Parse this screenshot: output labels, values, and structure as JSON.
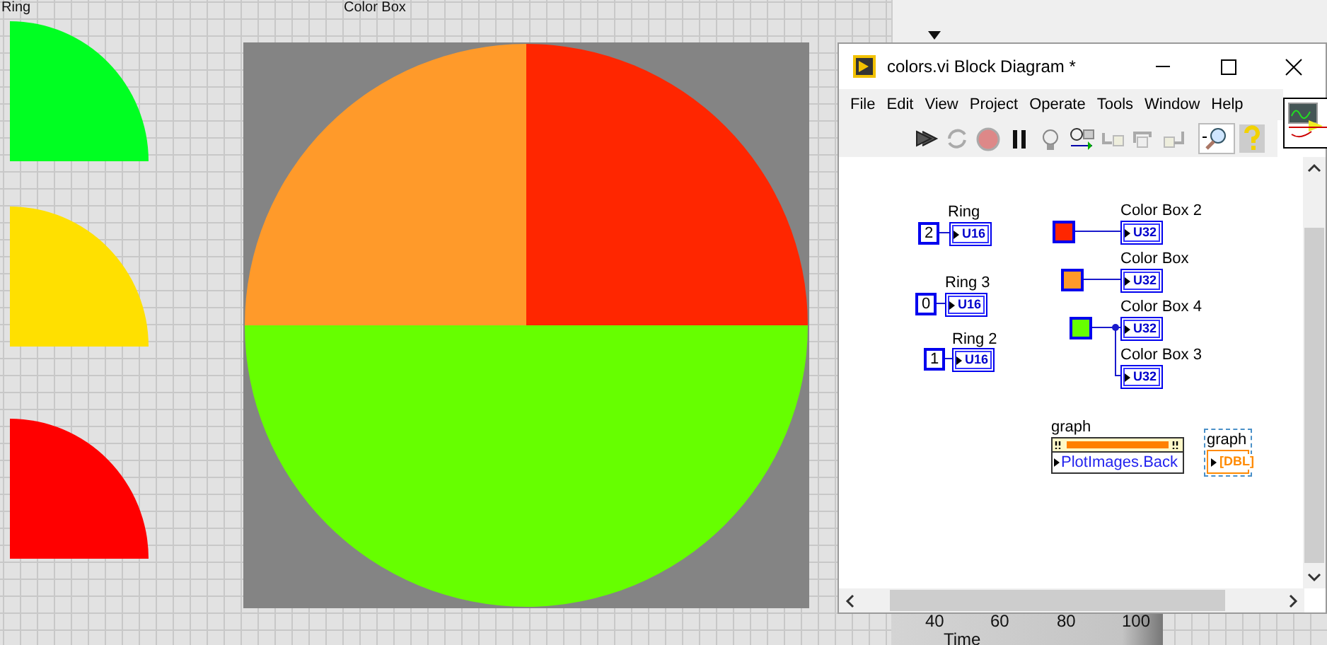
{
  "front_panel": {
    "ring_label": "Ring",
    "color_box_label": "Color Box",
    "rings": [
      {
        "color": "#00ff22"
      },
      {
        "color": "#ffe000"
      },
      {
        "color": "#ff0000"
      }
    ],
    "color_box_segments": [
      {
        "kind": "top-right",
        "color": "#ff2600"
      },
      {
        "kind": "top-left",
        "color": "#ff9a2a"
      },
      {
        "kind": "bottom",
        "color": "#66ff00"
      }
    ]
  },
  "back_window": {
    "axis_ticks": [
      "40",
      "60",
      "80",
      "100"
    ],
    "axis_label": "Time"
  },
  "block_diagram": {
    "title": "colors.vi Block Diagram *",
    "menu": [
      "File",
      "Edit",
      "View",
      "Project",
      "Operate",
      "Tools",
      "Window",
      "Help"
    ],
    "ring_constants": [
      {
        "value": "2",
        "label": "Ring",
        "type": "U16"
      },
      {
        "value": "0",
        "label": "Ring 3",
        "type": "U16"
      },
      {
        "value": "1",
        "label": "Ring 2",
        "type": "U16"
      }
    ],
    "color_constants": [
      {
        "color": "#ff2600",
        "terminals": [
          {
            "label": "Color Box 2",
            "type": "U32"
          }
        ]
      },
      {
        "color": "#ff9a2a",
        "terminals": [
          {
            "label": "Color Box",
            "type": "U32"
          }
        ]
      },
      {
        "color": "#66ff00",
        "terminals": [
          {
            "label": "Color Box 4",
            "type": "U32"
          },
          {
            "label": "Color Box 3",
            "type": "U32"
          }
        ]
      }
    ],
    "property_node": {
      "label": "graph",
      "property": "PlotImages.Back"
    },
    "graph_terminal": {
      "label": "graph",
      "type": "[DBL]"
    }
  }
}
